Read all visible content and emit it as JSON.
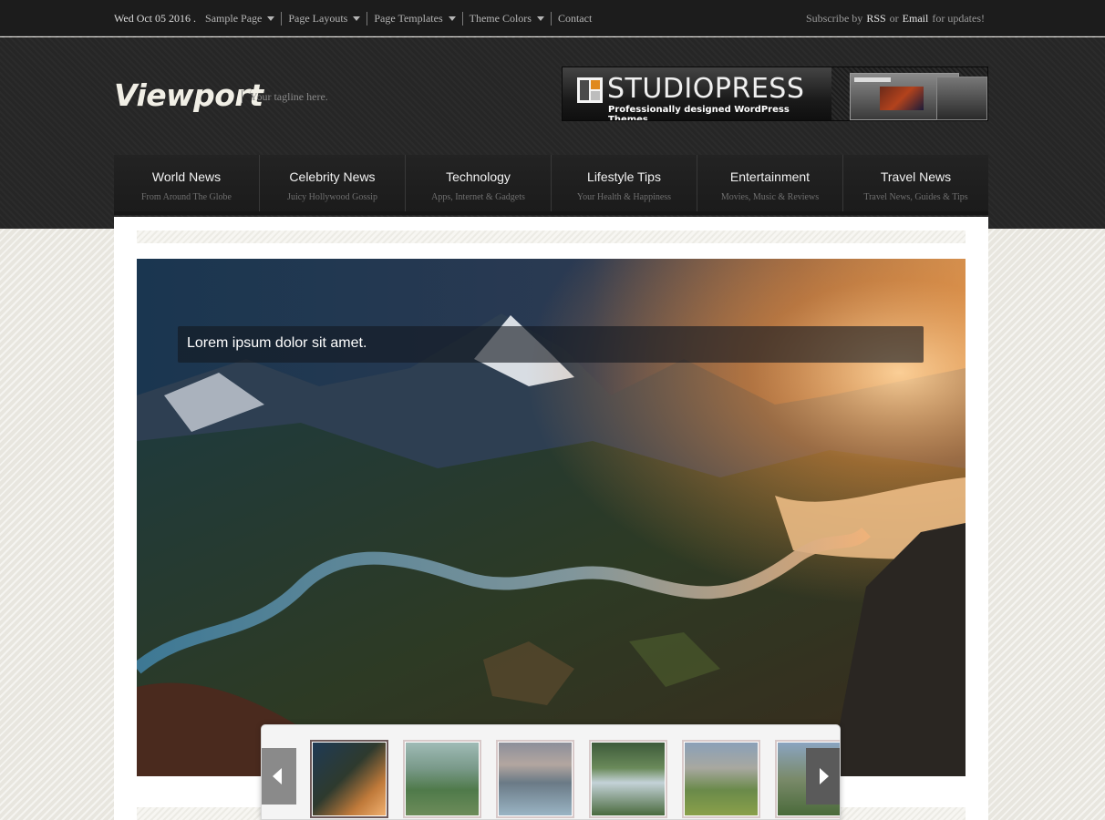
{
  "topbar": {
    "date": "Wed Oct 05 2016",
    "date_sep": ".",
    "menu": [
      {
        "label": "Sample Page",
        "has_dropdown": true
      },
      {
        "label": "Page Layouts",
        "has_dropdown": true
      },
      {
        "label": "Page Templates",
        "has_dropdown": true
      },
      {
        "label": "Theme Colors",
        "has_dropdown": true
      },
      {
        "label": "Contact",
        "has_dropdown": false
      }
    ],
    "subscribe": {
      "prefix": "Subscribe by",
      "rss": "RSS",
      "or": "or",
      "email": "Email",
      "suffix": "for updates!"
    }
  },
  "header": {
    "site_title": "Viewport",
    "tagline": "Your tagline here.",
    "banner": {
      "brand": "STUDIOPRESS",
      "subtitle": "Professionally designed WordPress Themes"
    }
  },
  "nav": [
    {
      "title": "World News",
      "subtitle": "From Around The Globe"
    },
    {
      "title": "Celebrity News",
      "subtitle": "Juicy Hollywood Gossip"
    },
    {
      "title": "Technology",
      "subtitle": "Apps, Internet & Gadgets"
    },
    {
      "title": "Lifestyle Tips",
      "subtitle": "Your Health & Happiness"
    },
    {
      "title": "Entertainment",
      "subtitle": "Movies, Music & Reviews"
    },
    {
      "title": "Travel News",
      "subtitle": "Travel News, Guides & Tips"
    }
  ],
  "slider": {
    "caption": "Lorem ipsum dolor sit amet.",
    "thumbnails": [
      "mountain-valley-sunset",
      "tropical-peaks",
      "mountain-lake-reflection",
      "waterfall-forest",
      "waterfall-cliffs",
      "lakeside-trees"
    ],
    "active_thumb": 0
  },
  "colors": {
    "topbar_bg": "#1c1c1c",
    "header_bg": "#262626",
    "nav_bg": "#1f1f1f",
    "page_bg": "#e8e6df"
  },
  "icons": {
    "dropdown": "chevron-down-icon",
    "prev": "arrow-left-icon",
    "next": "arrow-right-icon"
  }
}
